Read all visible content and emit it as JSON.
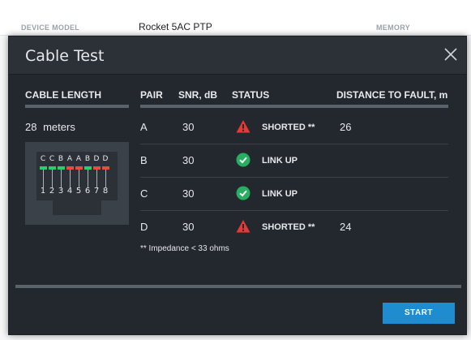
{
  "background": {
    "device_model_label": "DEVICE MODEL",
    "device_model_value": "Rocket 5AC PTP",
    "memory_label": "MEMORY"
  },
  "modal": {
    "title": "Cable Test",
    "close_icon": "close-icon",
    "cable_length_header": "CABLE LENGTH",
    "cable_length_value": "28",
    "cable_length_unit": "meters",
    "columns": {
      "pair": "PAIR",
      "snr": "SNR, dB",
      "status": "STATUS",
      "distance": "DISTANCE TO FAULT, m"
    },
    "jack": {
      "letters": [
        "C",
        "C",
        "B",
        "A",
        "A",
        "B",
        "D",
        "D"
      ],
      "numbers": [
        "1",
        "2",
        "3",
        "4",
        "5",
        "6",
        "7",
        "8"
      ],
      "pin_colors": [
        "#2ecc71",
        "#2ecc71",
        "#2ecc71",
        "#e74c3c",
        "#e74c3c",
        "#2ecc71",
        "#e74c3c",
        "#e74c3c"
      ]
    },
    "rows": [
      {
        "pair": "A",
        "snr": "30",
        "status": "SHORTED **",
        "icon": "warning-icon",
        "distance": "26"
      },
      {
        "pair": "B",
        "snr": "30",
        "status": "LINK UP",
        "icon": "check-circle-icon",
        "distance": ""
      },
      {
        "pair": "C",
        "snr": "30",
        "status": "LINK UP",
        "icon": "check-circle-icon",
        "distance": ""
      },
      {
        "pair": "D",
        "snr": "30",
        "status": "SHORTED **",
        "icon": "warning-icon",
        "distance": "24"
      }
    ],
    "note": "** Impedance < 33 ohms",
    "start_label": "START"
  },
  "colors": {
    "warning": "#e53935",
    "ok": "#27ae60",
    "accent": "#1f8ccf"
  }
}
